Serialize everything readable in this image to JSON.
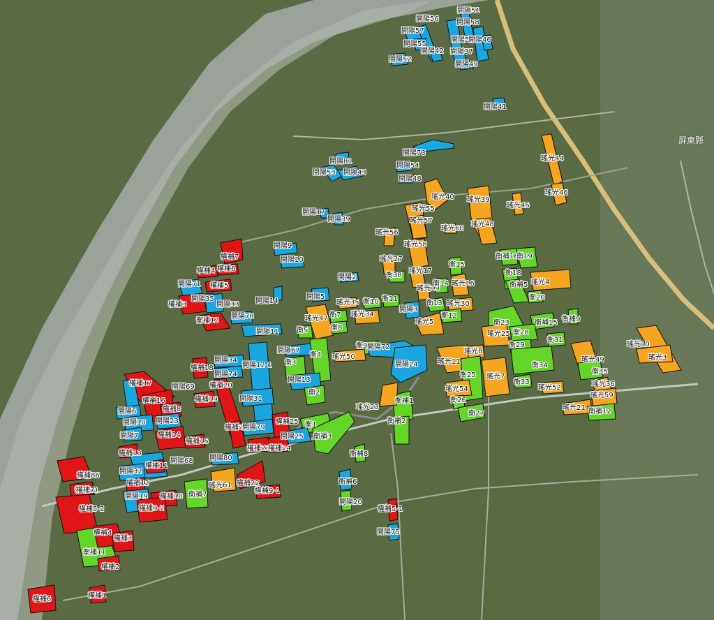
{
  "county_label": "屏東縣",
  "colors": {
    "kaiyang": "#1aa7e0",
    "yaoguang": "#f5a51f",
    "hengbu": "#e01515",
    "hengnbu": "#63d628",
    "outline": "#111111"
  },
  "categories": [
    "開陽",
    "瑤光",
    "權補",
    "衡補"
  ],
  "parcels": [
    {
      "label": "開陽56",
      "cat": "kaiyang"
    },
    {
      "label": "開陽51",
      "cat": "kaiyang"
    },
    {
      "label": "開陽57",
      "cat": "kaiyang"
    },
    {
      "label": "開陽58",
      "cat": "kaiyang"
    },
    {
      "label": "開陽55",
      "cat": "kaiyang"
    },
    {
      "label": "開陽50",
      "cat": "kaiyang"
    },
    {
      "label": "開陽46",
      "cat": "kaiyang"
    },
    {
      "label": "開陽42",
      "cat": "kaiyang"
    },
    {
      "label": "開陽37",
      "cat": "kaiyang"
    },
    {
      "label": "開陽52",
      "cat": "kaiyang"
    },
    {
      "label": "開陽49",
      "cat": "kaiyang"
    },
    {
      "label": "開陽41",
      "cat": "kaiyang"
    },
    {
      "label": "開陽73",
      "cat": "kaiyang"
    },
    {
      "label": "開陽81",
      "cat": "kaiyang"
    },
    {
      "label": "開陽54",
      "cat": "kaiyang"
    },
    {
      "label": "開陽53",
      "cat": "kaiyang"
    },
    {
      "label": "開陽43",
      "cat": "kaiyang"
    },
    {
      "label": "開陽48",
      "cat": "kaiyang"
    },
    {
      "label": "瑤光44",
      "cat": "yaoguang"
    },
    {
      "label": "瑤光40",
      "cat": "yaoguang"
    },
    {
      "label": "瑤光55",
      "cat": "yaoguang"
    },
    {
      "label": "瑤光39",
      "cat": "yaoguang"
    },
    {
      "label": "瑤光46",
      "cat": "yaoguang"
    },
    {
      "label": "瑤光45",
      "cat": "yaoguang"
    },
    {
      "label": "開陽17",
      "cat": "kaiyang"
    },
    {
      "label": "開陽39",
      "cat": "kaiyang"
    },
    {
      "label": "瑤光57",
      "cat": "yaoguang"
    },
    {
      "label": "瑤光48",
      "cat": "yaoguang"
    },
    {
      "label": "瑤光56",
      "cat": "yaoguang"
    },
    {
      "label": "瑤光60",
      "cat": "yaoguang"
    },
    {
      "label": "瑤光58",
      "cat": "yaoguang"
    },
    {
      "label": "開陽9",
      "cat": "kaiyang"
    },
    {
      "label": "權補7",
      "cat": "hengbu"
    },
    {
      "label": "開陽10",
      "cat": "kaiyang"
    },
    {
      "label": "瑤光27",
      "cat": "yaoguang"
    },
    {
      "label": "衡補16",
      "cat": "hengnbu"
    },
    {
      "label": "衡19",
      "cat": "hengnbu"
    },
    {
      "label": "衡15",
      "cat": "hengnbu"
    },
    {
      "label": "權補4",
      "cat": "hengbu"
    },
    {
      "label": "權補6",
      "cat": "hengbu"
    },
    {
      "label": "瑤光17",
      "cat": "yaoguang"
    },
    {
      "label": "衡18",
      "cat": "hengnbu"
    },
    {
      "label": "開陽2",
      "cat": "kaiyang"
    },
    {
      "label": "衡38",
      "cat": "hengnbu"
    },
    {
      "label": "開陽71",
      "cat": "kaiyang"
    },
    {
      "label": "權補5",
      "cat": "hengbu"
    },
    {
      "label": "瑤光19",
      "cat": "yaoguang"
    },
    {
      "label": "衡14",
      "cat": "hengnbu"
    },
    {
      "label": "瑤光16",
      "cat": "yaoguang"
    },
    {
      "label": "衡補5",
      "cat": "hengnbu"
    },
    {
      "label": "瑤光4",
      "cat": "yaoguang"
    },
    {
      "label": "開陽35",
      "cat": "kaiyang"
    },
    {
      "label": "開陽5",
      "cat": "kaiyang"
    },
    {
      "label": "衡20",
      "cat": "hengnbu"
    },
    {
      "label": "權補3",
      "cat": "hengbu"
    },
    {
      "label": "開陽33",
      "cat": "kaiyang"
    },
    {
      "label": "開陽14",
      "cat": "kaiyang"
    },
    {
      "label": "瑤光35",
      "cat": "yaoguang"
    },
    {
      "label": "衡10",
      "cat": "hengnbu"
    },
    {
      "label": "衡11",
      "cat": "hengnbu"
    },
    {
      "label": "衡13",
      "cat": "hengnbu"
    },
    {
      "label": "瑤光30",
      "cat": "yaoguang"
    },
    {
      "label": "衡補9",
      "cat": "hengnbu"
    },
    {
      "label": "開陽3",
      "cat": "kaiyang"
    },
    {
      "label": "衡補12",
      "cat": "hengbu"
    },
    {
      "label": "開陽78",
      "cat": "kaiyang"
    },
    {
      "label": "瑤光47",
      "cat": "yaoguang"
    },
    {
      "label": "瑤光34",
      "cat": "yaoguang"
    },
    {
      "label": "衡12",
      "cat": "hengnbu"
    },
    {
      "label": "衡23",
      "cat": "hengnbu"
    },
    {
      "label": "衡補15",
      "cat": "hengnbu"
    },
    {
      "label": "衡7",
      "cat": "hengnbu"
    },
    {
      "label": "瑤光5",
      "cat": "yaoguang"
    },
    {
      "label": "衡28",
      "cat": "hengnbu"
    },
    {
      "label": "開陽11",
      "cat": "kaiyang"
    },
    {
      "label": "衡5",
      "cat": "hengnbu"
    },
    {
      "label": "衡8",
      "cat": "hengnbu"
    },
    {
      "label": "瑤光25",
      "cat": "yaoguang"
    },
    {
      "label": "衡31",
      "cat": "hengnbu"
    },
    {
      "label": "瑤光10",
      "cat": "yaoguang"
    },
    {
      "label": "衡29",
      "cat": "hengnbu"
    },
    {
      "label": "開陽67",
      "cat": "kaiyang"
    },
    {
      "label": "衡4",
      "cat": "hengnbu"
    },
    {
      "label": "衡9",
      "cat": "hengnbu"
    },
    {
      "label": "開陽72",
      "cat": "kaiyang"
    },
    {
      "label": "瑤光8",
      "cat": "yaoguang"
    },
    {
      "label": "瑤光49",
      "cat": "yaoguang"
    },
    {
      "label": "開陽34",
      "cat": "kaiyang"
    },
    {
      "label": "開陽12-1",
      "cat": "kaiyang"
    },
    {
      "label": "瑤光50",
      "cat": "yaoguang"
    },
    {
      "label": "瑤光3",
      "cat": "yaoguang"
    },
    {
      "label": "衡3",
      "cat": "hengnbu"
    },
    {
      "label": "權補18",
      "cat": "hengbu"
    },
    {
      "label": "開陽24",
      "cat": "kaiyang"
    },
    {
      "label": "瑤光11",
      "cat": "yaoguang"
    },
    {
      "label": "衡34",
      "cat": "hengnbu"
    },
    {
      "label": "開陽74",
      "cat": "kaiyang"
    },
    {
      "label": "衡25",
      "cat": "hengnbu"
    },
    {
      "label": "瑤光7",
      "cat": "yaoguang"
    },
    {
      "label": "衡33",
      "cat": "hengnbu"
    },
    {
      "label": "衡35",
      "cat": "hengnbu"
    },
    {
      "label": "開陽13",
      "cat": "kaiyang"
    },
    {
      "label": "權補20",
      "cat": "hengbu"
    },
    {
      "label": "權補17",
      "cat": "hengbu"
    },
    {
      "label": "開陽69",
      "cat": "kaiyang"
    },
    {
      "label": "衡2",
      "cat": "hengnbu"
    },
    {
      "label": "瑤光36",
      "cat": "yaoguang"
    },
    {
      "label": "瑤光52",
      "cat": "yaoguang"
    },
    {
      "label": "權補16",
      "cat": "hengbu"
    },
    {
      "label": "權補19",
      "cat": "hengbu"
    },
    {
      "label": "開陽31",
      "cat": "kaiyang"
    },
    {
      "label": "衡補1",
      "cat": "hengnbu"
    },
    {
      "label": "瑤光54",
      "cat": "yaoguang"
    },
    {
      "label": "瑤光59",
      "cat": "yaoguang"
    },
    {
      "label": "開陽6",
      "cat": "kaiyang"
    },
    {
      "label": "權補8",
      "cat": "hengbu"
    },
    {
      "label": "衡26",
      "cat": "hengnbu"
    },
    {
      "label": "瑤光23",
      "cat": "yaoguang"
    },
    {
      "label": "瑤光21",
      "cat": "yaoguang"
    },
    {
      "label": "衡補12",
      "cat": "hengnbu"
    },
    {
      "label": "開陽10",
      "cat": "kaiyang"
    },
    {
      "label": "開陽23",
      "cat": "kaiyang"
    },
    {
      "label": "權補25",
      "cat": "hengbu"
    },
    {
      "label": "衡27",
      "cat": "hengnbu"
    },
    {
      "label": "衡補2",
      "cat": "hengnbu"
    },
    {
      "label": "開陽7",
      "cat": "kaiyang"
    },
    {
      "label": "權補21",
      "cat": "hengbu"
    },
    {
      "label": "開陽79",
      "cat": "kaiyang"
    },
    {
      "label": "衡1",
      "cat": "hengnbu"
    },
    {
      "label": "權補14",
      "cat": "hengbu"
    },
    {
      "label": "開陽25",
      "cat": "kaiyang"
    },
    {
      "label": "衡補3",
      "cat": "hengnbu"
    },
    {
      "label": "權補15",
      "cat": "hengbu"
    },
    {
      "label": "權補23",
      "cat": "hengbu"
    },
    {
      "label": "權補24",
      "cat": "hengbu"
    },
    {
      "label": "權補13",
      "cat": "hengbu"
    },
    {
      "label": "開陽68",
      "cat": "kaiyang"
    },
    {
      "label": "開陽80",
      "cat": "kaiyang"
    },
    {
      "label": "衡補8",
      "cat": "hengnbu"
    },
    {
      "label": "權補11",
      "cat": "hengbu"
    },
    {
      "label": "開陽32",
      "cat": "kaiyang"
    },
    {
      "label": "權補12",
      "cat": "hengbu"
    },
    {
      "label": "瑤光61",
      "cat": "yaoguang"
    },
    {
      "label": "權補22",
      "cat": "hengbu"
    },
    {
      "label": "衡補4",
      "cat": "hengnbu"
    },
    {
      "label": "權補26",
      "cat": "hengbu"
    },
    {
      "label": "衡補10",
      "cat": "hengnbu"
    },
    {
      "label": "權補9-1",
      "cat": "hengbu"
    },
    {
      "label": "開陽19",
      "cat": "kaiyang"
    },
    {
      "label": "權補10",
      "cat": "hengbu"
    },
    {
      "label": "衡補7",
      "cat": "hengnbu"
    },
    {
      "label": "開陽20",
      "cat": "kaiyang"
    },
    {
      "label": "權補9-2",
      "cat": "hengbu"
    },
    {
      "label": "權補5-1",
      "cat": "hengbu"
    },
    {
      "label": "衡補6",
      "cat": "hengnbu"
    },
    {
      "label": "權補5-2",
      "cat": "hengbu"
    },
    {
      "label": "開陽75",
      "cat": "kaiyang"
    },
    {
      "label": "衡補11",
      "cat": "hengnbu"
    },
    {
      "label": "權補4",
      "cat": "hengbu"
    },
    {
      "label": "權補3",
      "cat": "hengbu"
    },
    {
      "label": "權補2",
      "cat": "hengbu"
    },
    {
      "label": "權補1",
      "cat": "hengbu"
    },
    {
      "label": "權補6",
      "cat": "hengbu"
    },
    {
      "label": "權補8",
      "cat": "hengbu"
    },
    {
      "label": "權補7",
      "cat": "hengbu"
    }
  ]
}
